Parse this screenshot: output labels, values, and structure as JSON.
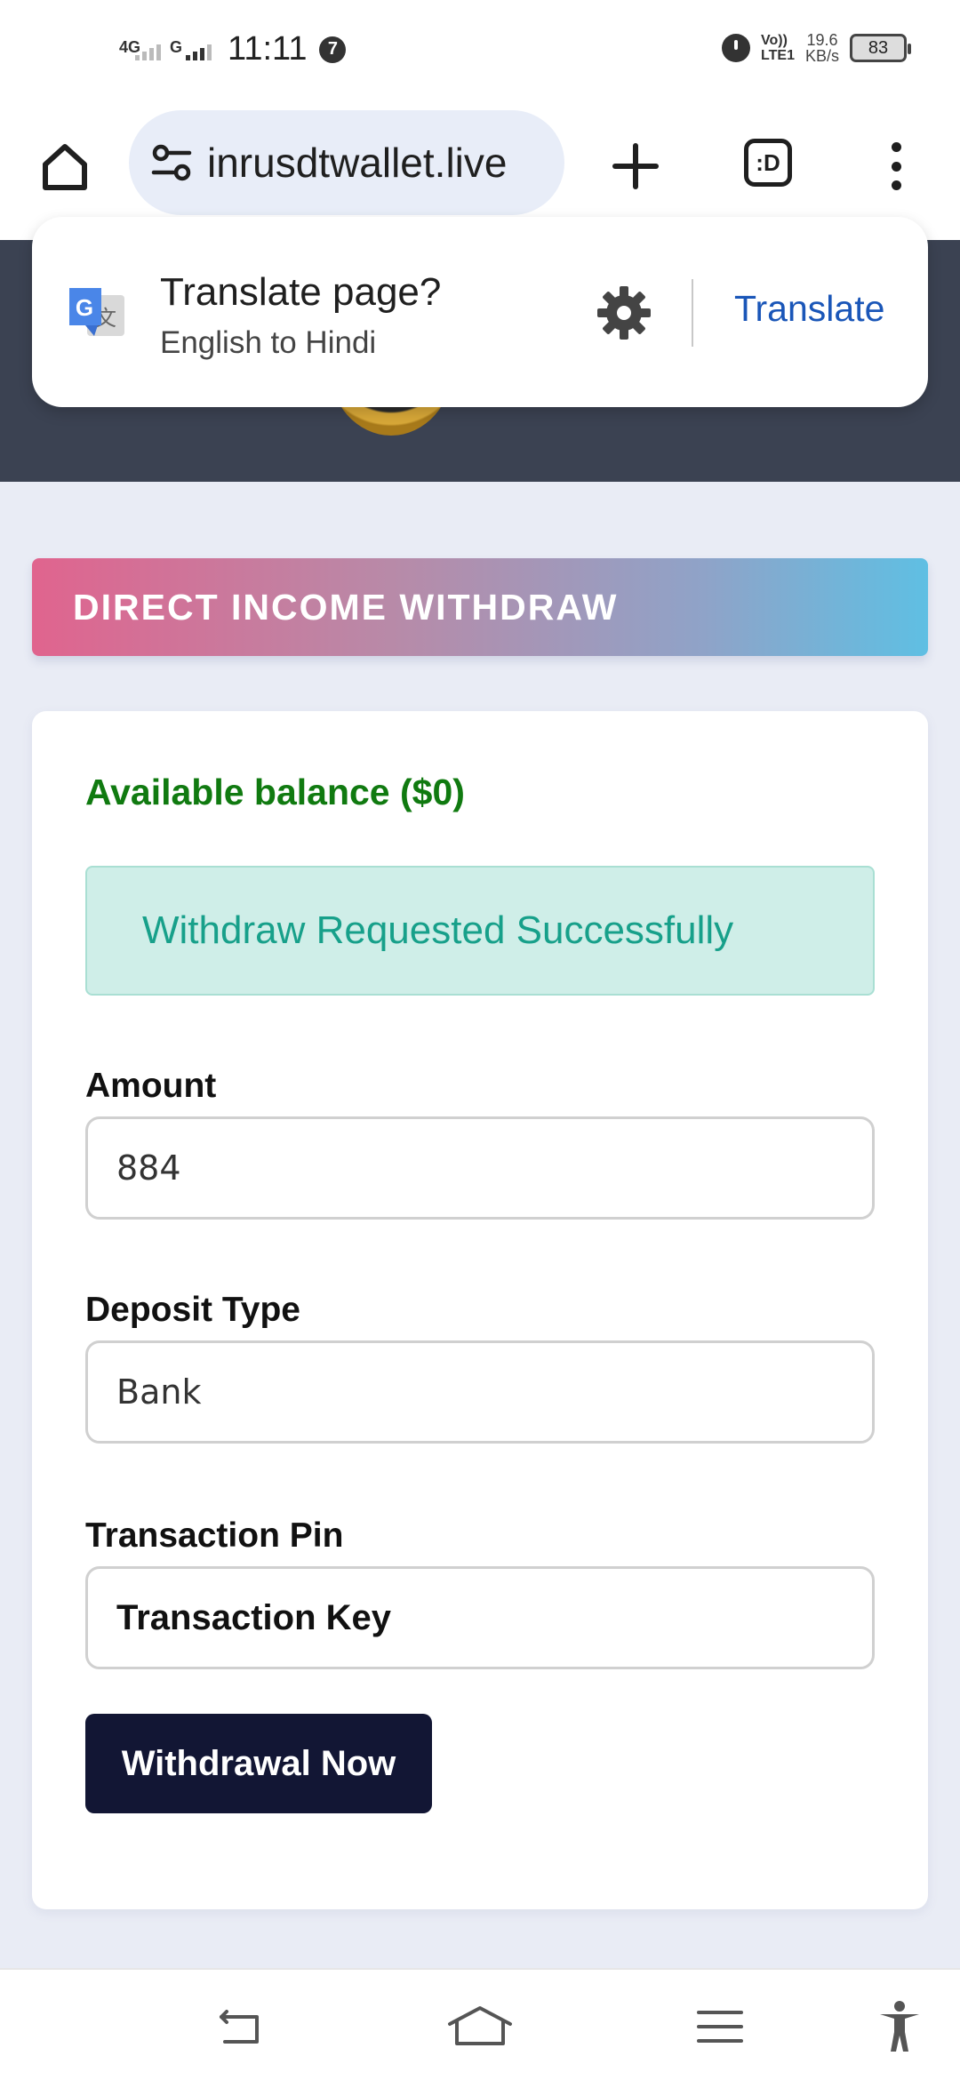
{
  "status_bar": {
    "network_left_1": "4G",
    "network_left_2": "G",
    "time": "11:11",
    "notification_count": "7",
    "volte_line1": "Vo))",
    "volte_line2": "LTE1",
    "speed_value": "19.6",
    "speed_unit": "KB/s",
    "battery": "83"
  },
  "browser": {
    "url": "inrusdtwallet.live",
    "tabs_label": ":D"
  },
  "translate_popup": {
    "title": "Translate page?",
    "subtitle": "English to Hindi",
    "action": "Translate"
  },
  "page": {
    "title": "DIRECT INCOME WITHDRAW",
    "balance": "Available balance ($0)",
    "alert": "Withdraw Requested Successfully",
    "fields": [
      {
        "label": "Amount",
        "value": "884"
      },
      {
        "label": "Deposit Type",
        "value": "Bank"
      },
      {
        "label": "Transaction Pin",
        "placeholder": "Transaction Key"
      }
    ],
    "submit_label": "Withdrawal Now"
  },
  "colors": {
    "header_bg": "#3b4252",
    "balance_green": "#107a10",
    "alert_bg": "#cfeee8",
    "alert_text": "#17a08a",
    "button_bg": "#121634",
    "translate_blue": "#1a56b8"
  },
  "icons": {
    "home": "home-icon",
    "site_info": "tune-icon",
    "new_tab": "plus-icon",
    "menu": "more-vert-icon",
    "translate": "google-translate-icon",
    "settings": "gear-icon",
    "back": "back-icon",
    "home_nav": "home-nav-icon",
    "recents": "menu-lines-icon",
    "accessibility": "accessibility-icon"
  }
}
